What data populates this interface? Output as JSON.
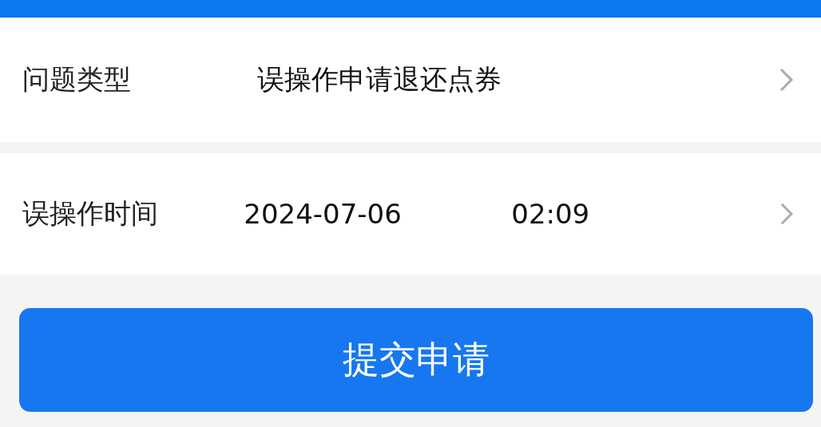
{
  "rows": [
    {
      "label": "问题类型",
      "values": [
        "误操作申请退还点券"
      ]
    },
    {
      "label": "误操作时间",
      "values": [
        "2024-07-06",
        "02:09"
      ]
    }
  ],
  "submit_button": {
    "label": "提交申请"
  }
}
